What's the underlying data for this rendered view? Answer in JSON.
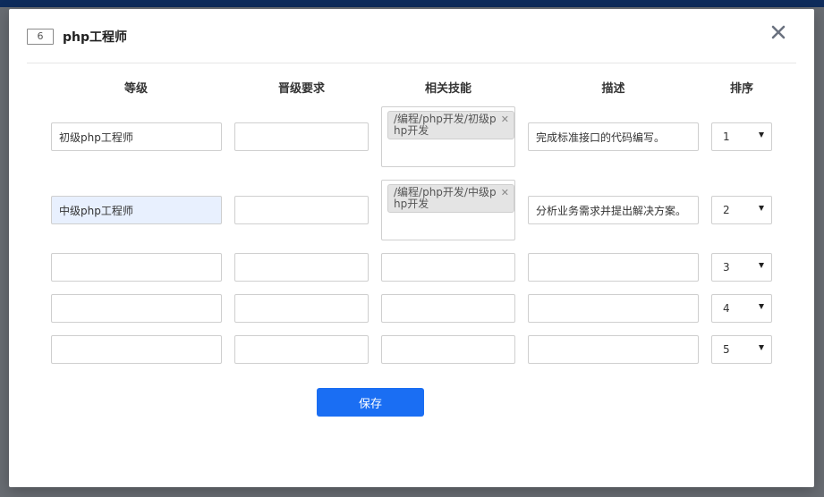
{
  "modal": {
    "id_badge": "6",
    "title": "php工程师",
    "close_glyph": "✕"
  },
  "table": {
    "headers": [
      "等级",
      "晋级要求",
      "相关技能",
      "描述",
      "排序"
    ],
    "rows": [
      {
        "level": "初级php工程师",
        "requirement": "",
        "skill_tag": "/编程/php开发/初级php开发",
        "description": "完成标准接口的代码编写。",
        "order": "1"
      },
      {
        "level": "中级php工程师",
        "requirement": "",
        "skill_tag": "/编程/php开发/中级php开发",
        "description": "分析业务需求并提出解决方案。",
        "order": "2"
      },
      {
        "level": "",
        "requirement": "",
        "skill_tag": "",
        "description": "",
        "order": "3"
      },
      {
        "level": "",
        "requirement": "",
        "skill_tag": "",
        "description": "",
        "order": "4"
      },
      {
        "level": "",
        "requirement": "",
        "skill_tag": "",
        "description": "",
        "order": "5"
      }
    ]
  },
  "save_label": "保存",
  "colors": {
    "primary": "#1a6ef3",
    "highlight_field": "#e8f0fe"
  },
  "icons": {
    "close": "close-icon",
    "tag_remove": "tag-remove-icon",
    "select_arrow": "chevron-down-icon"
  }
}
